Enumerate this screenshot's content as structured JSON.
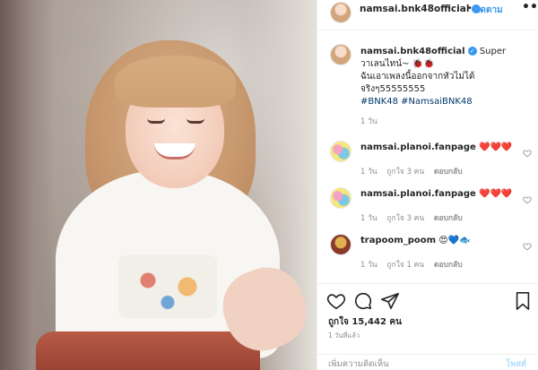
{
  "post": {
    "username": "namsai.bnk48official",
    "follow_dot": "•",
    "follow_label": "ติดตาม",
    "more_label": "•••",
    "caption": {
      "username": "namsai.bnk48official",
      "line1": "Super",
      "line2": "วาเลนไทน์~ 🐞🐞",
      "line3": "ฉันเอาเพลงนี้ออกจากหัวไม่ได้",
      "line4": "จริงๆ55555555",
      "tags": "#BNK48 #NamsaiBNK48",
      "time": "1 วัน"
    },
    "comments": [
      {
        "username": "namsai.planoi.fanpage",
        "text": "❤️❤️❤️",
        "time": "1 วัน",
        "likes": "ถูกใจ 3 คน",
        "reply": "ตอบกลับ",
        "avatar": "planoi"
      },
      {
        "username": "namsai.planoi.fanpage",
        "text": "❤️❤️❤️",
        "time": "1 วัน",
        "likes": "ถูกใจ 3 คน",
        "reply": "ตอบกลับ",
        "avatar": "planoi"
      },
      {
        "username": "trapoom_poom",
        "text": "😍💙🐟",
        "time": "1 วัน",
        "likes": "ถูกใจ 1 คน",
        "reply": "ตอบกลับ",
        "avatar": "trapoom"
      }
    ],
    "likes_count": "ถูกใจ 15,442 คน",
    "posted_ago": "1 วันที่แล้ว",
    "comment_placeholder": "เพิ่มความคิดเห็น",
    "post_label": "โพสต์"
  },
  "icons": {
    "verified": "verified-badge-icon",
    "like": "heart-icon",
    "comment": "comment-bubble-icon",
    "share": "paper-plane-icon",
    "save": "bookmark-icon",
    "comment_like": "small-heart-icon"
  },
  "colors": {
    "link_blue": "#3897f0",
    "hashtag": "#00376b",
    "secondary_text": "#8e8e8e",
    "post_button_disabled": "#b2dffc"
  }
}
